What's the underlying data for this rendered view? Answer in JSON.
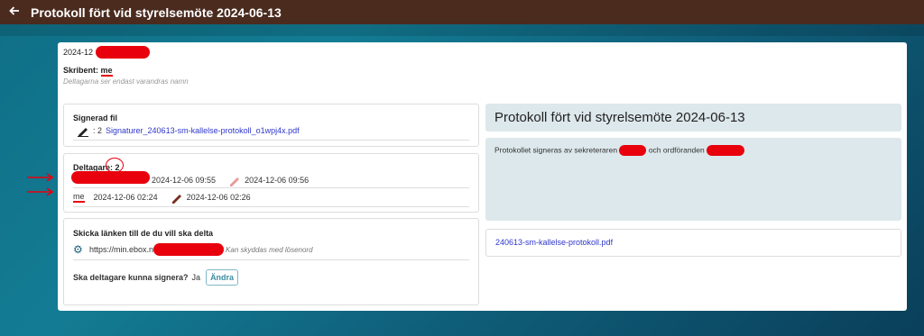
{
  "topbar": {
    "back_icon": "arrow-left-icon",
    "title": "Protokoll fört vid styrelsemöte 2024-06-13"
  },
  "meta": {
    "date_prefix": "2024-12",
    "scribe_label": "Skribent:",
    "scribe_value": "me",
    "hint": "Deltagarna ser endast varandras namn"
  },
  "signed_file": {
    "title": "Signerad fil",
    "prefix": ": 2",
    "filename": "Signaturer_240613-sm-kallelse-protokoll_o1wpj4x.pdf"
  },
  "participants": {
    "title": "Deltagare: 2",
    "rows": [
      {
        "name": "",
        "signed_at": "2024-12-06 09:55",
        "edited_at": "2024-12-06 09:56"
      },
      {
        "name": "me",
        "signed_at": "2024-12-06 02:24",
        "edited_at": "2024-12-06 02:26"
      }
    ]
  },
  "share": {
    "title": "Skicka länken till de du vill ska delta",
    "url_prefix": "https://min.ebox.n",
    "protected_note": "Kan skyddas med lösenord",
    "sign_question": "Ska deltagare kunna signera?",
    "sign_answer": "Ja",
    "change_button": "Ändra"
  },
  "document": {
    "title": "Protokoll fört vid styrelsemöte 2024-06-13",
    "desc_part1": "Protokollet signeras av sekreteraren",
    "desc_part2": "och ordföranden",
    "attachment": "240613-sm-kallelse-protokoll.pdf"
  },
  "colors": {
    "topbar": "#4a2b1e",
    "link": "#2f37c9",
    "panel": "#dde8ec",
    "annotation_red": "#e8000d"
  }
}
